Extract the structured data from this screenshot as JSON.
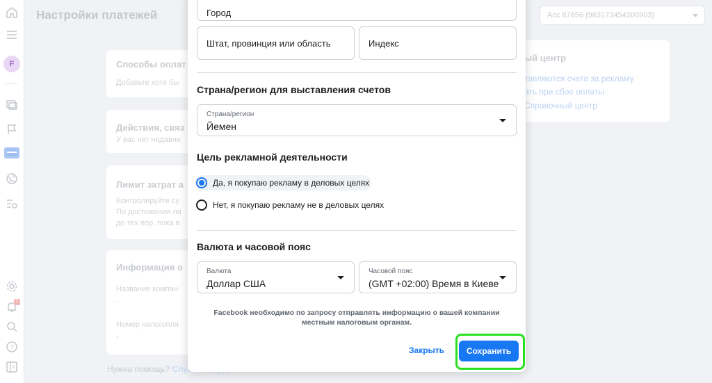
{
  "page": {
    "title": "Настройки платежей",
    "account_selector": "Acc 87656 (963173454200903)"
  },
  "sidebar": {
    "avatar_letter": "F",
    "notification_count": "1"
  },
  "background_cards": {
    "payment_methods": {
      "title": "Способы оплат",
      "text": "Добавьте хотя бы"
    },
    "actions": {
      "title": "Действия, связ",
      "text": "У вас нет недавни"
    },
    "spend_limit": {
      "title": "Лимит затрат а",
      "lines": [
        "Контролируйте су",
        "По достижении ли",
        "до тех пор, пока в"
      ]
    },
    "business_info": {
      "title": "Информация о",
      "label1": "Название компан",
      "value1": "-",
      "label2": "Номер налогопла",
      "value2": "-"
    }
  },
  "help_center": {
    "title": "ый центр",
    "links": [
      "тавляются счета за рекламу",
      "ать при сбое оплаты",
      "Справочный центр"
    ]
  },
  "help_footer": {
    "text": "Нужна помощь?",
    "link": "Служба поддержки"
  },
  "modal": {
    "city_placeholder": "Город",
    "state_placeholder": "Штат, провинция или область",
    "zip_placeholder": "Индекс",
    "country_section_title": "Страна/регион для выставления счетов",
    "country_label": "Страна/регион",
    "country_value": "Йемен",
    "purpose_section_title": "Цель рекламной деятельности",
    "purpose_options": [
      {
        "label": "Да, я покупаю рекламу в деловых целях",
        "selected": true
      },
      {
        "label": "Нет, я покупаю рекламу не в деловых целях",
        "selected": false
      }
    ],
    "currency_section_title": "Валюта и часовой пояс",
    "currency_label": "Валюта",
    "currency_value": "Доллар США",
    "timezone_label": "Часовой пояс",
    "timezone_value": "(GMT +02:00) Время в Киеве",
    "notice": "Facebook необходимо по запросу отправлять информацию о вашей компании местным налоговым органам.",
    "close_label": "Закрыть",
    "save_label": "Сохранить"
  },
  "colors": {
    "accent": "#1877f2",
    "highlight": "#27e01f",
    "background": "#f0f2f5"
  }
}
